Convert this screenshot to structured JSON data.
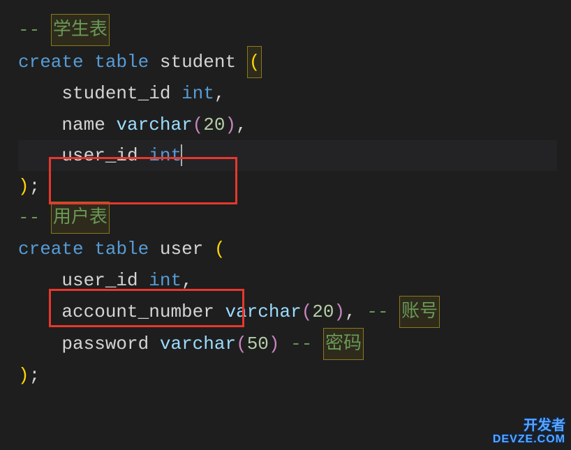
{
  "colors": {
    "bg": "#1e1e1e",
    "comment": "#6a9955",
    "keyword": "#569cd6",
    "ident": "#d4d4d4",
    "number": "#b5cea8",
    "paren_yellow": "#ffd700",
    "paren_pink": "#c586c0",
    "highlight_border": "#8a7a1a",
    "red_box": "#e8372c"
  },
  "line1": {
    "comment_prefix": "-- ",
    "comment_text": "学生表"
  },
  "line2": {
    "kw1": "create",
    "kw2": "table",
    "name": "student",
    "paren": "("
  },
  "line3": {
    "col": "student_id",
    "type": "int",
    "comma": ","
  },
  "line4": {
    "col": "name",
    "type": "varchar",
    "lp": "(",
    "sz": "20",
    "rp": ")",
    "comma": ","
  },
  "line5": {
    "col": "user_id",
    "type": "int"
  },
  "line6": {
    "paren": ")",
    "semi": ";"
  },
  "line7": {
    "comment_prefix": "-- ",
    "comment_text": "用户表"
  },
  "line8": {
    "kw1": "create",
    "kw2": "table",
    "name": "user",
    "paren": "("
  },
  "line9": {
    "col": "user_id",
    "type": "int",
    "comma": ","
  },
  "line10": {
    "col": "account_number",
    "type": "varchar",
    "lp": "(",
    "sz": "20",
    "rp": ")",
    "comma": ",",
    "cprefix": " -- ",
    "ctext": "账号"
  },
  "line11": {
    "col": "password",
    "type": "varchar",
    "lp": "(",
    "sz": "50",
    "rp": ")",
    "cprefix": " -- ",
    "ctext": "密码"
  },
  "line12": {
    "paren": ")",
    "semi": ";"
  },
  "watermark": {
    "line1": "开发者",
    "line2": "DEVZE.COM"
  }
}
